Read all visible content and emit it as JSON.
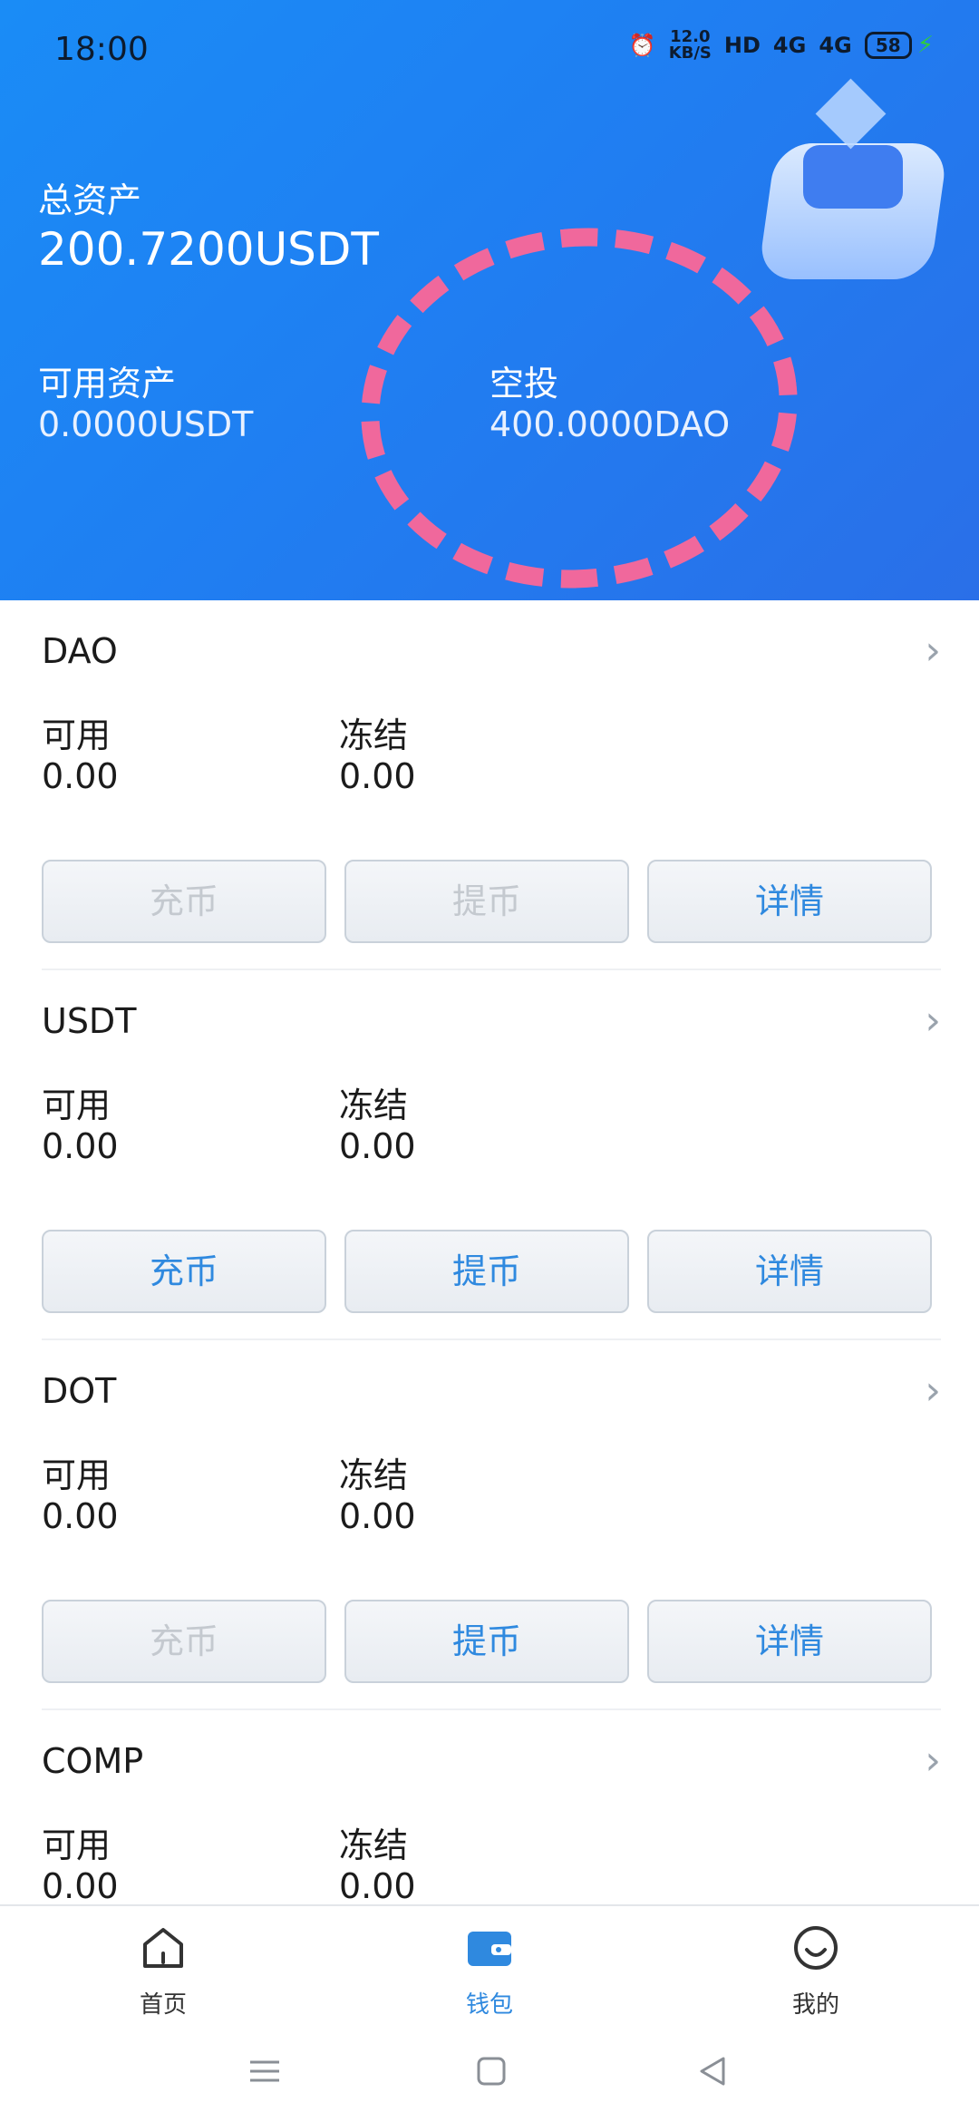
{
  "status": {
    "time": "18:00",
    "speed_value": "12.0",
    "speed_unit": "KB/S",
    "hd": "HD",
    "net1": "4G",
    "net2": "4G",
    "battery": "58"
  },
  "summary": {
    "total_label": "总资产",
    "total_value": "200.7200USDT",
    "available_label": "可用资产",
    "available_value": "0.0000USDT",
    "airdrop_label": "空投",
    "airdrop_value": "400.0000DAO"
  },
  "assets": [
    {
      "name": "DAO",
      "available_label": "可用",
      "available": "0.00",
      "frozen_label": "冻结",
      "frozen": "0.00",
      "deposit": "充币",
      "withdraw": "提币",
      "details": "详情"
    },
    {
      "name": "USDT",
      "available_label": "可用",
      "available": "0.00",
      "frozen_label": "冻结",
      "frozen": "0.00",
      "deposit": "充币",
      "withdraw": "提币",
      "details": "详情"
    },
    {
      "name": "DOT",
      "available_label": "可用",
      "available": "0.00",
      "frozen_label": "冻结",
      "frozen": "0.00",
      "deposit": "充币",
      "withdraw": "提币",
      "details": "详情"
    },
    {
      "name": "COMP",
      "available_label": "可用",
      "available": "0.00",
      "frozen_label": "冻结",
      "frozen": "0.00"
    }
  ],
  "nav": {
    "home": "首页",
    "wallet": "钱包",
    "mine": "我的"
  },
  "colors": {
    "accent": "#2f89df",
    "header_blue": "#1f7ff2",
    "highlight_pink": "#f0689c"
  }
}
